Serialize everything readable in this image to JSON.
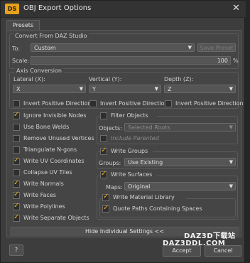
{
  "window": {
    "title": "OBJ Export Options",
    "app_icon_text": "DS",
    "close_glyph": "✕"
  },
  "tabs": {
    "presets": "Presets"
  },
  "convert": {
    "legend": "Convert From DAZ Studio",
    "to_label": "To:",
    "to_value": "Custom",
    "save_preset": "Save Preset",
    "scale_label": "Scale:",
    "scale_value": "100",
    "scale_unit": "%"
  },
  "axis": {
    "legend": "Axis Conversion",
    "lateral_label": "Lateral (X):",
    "lateral_value": "X",
    "vertical_label": "Vertical (Y):",
    "vertical_value": "Y",
    "depth_label": "Depth (Z):",
    "depth_value": "Z",
    "invert_x": "Invert Positive Direction",
    "invert_y": "Invert Positive Direction",
    "invert_z": "Invert Positive Direction"
  },
  "options": [
    {
      "label": "Ignore Invisible Nodes",
      "checked": true
    },
    {
      "label": "Use Bone Welds",
      "checked": false
    },
    {
      "label": "Remove Unused Vertices",
      "checked": false
    },
    {
      "label": "Triangulate N-gons",
      "checked": false
    },
    {
      "label": "Write UV Coordinates",
      "checked": true
    },
    {
      "label": "Collapse UV Tiles",
      "checked": false
    },
    {
      "label": "Write Normals",
      "checked": true
    },
    {
      "label": "Write Faces",
      "checked": true
    },
    {
      "label": "Write Polylines",
      "checked": true
    },
    {
      "label": "Write Separate Objects",
      "checked": true
    }
  ],
  "filter": {
    "label": "Filter Objects",
    "objects_label": "Objects:",
    "objects_value": "Selected Roots",
    "include_parented": "Include Parented"
  },
  "groups": {
    "label": "Write Groups",
    "groups_label": "Groups:",
    "groups_value": "Use Existing"
  },
  "surfaces": {
    "label": "Write Surfaces",
    "maps_label": "Maps:",
    "maps_value": "Original",
    "write_material_library": "Write Material Library",
    "quote_paths": "Quote Paths Containing Spaces"
  },
  "footer": {
    "hide_settings": "Hide Individual Settings <<",
    "help": "?",
    "accept": "Accept",
    "cancel": "Cancel"
  },
  "watermark": {
    "line1": "DAZ3D下载站",
    "line2": "DAZ3DDL.COM"
  },
  "colors": {
    "accent_check": "#f2b21a",
    "panel_bg": "#454545",
    "window_bg": "#3d3d3d"
  }
}
